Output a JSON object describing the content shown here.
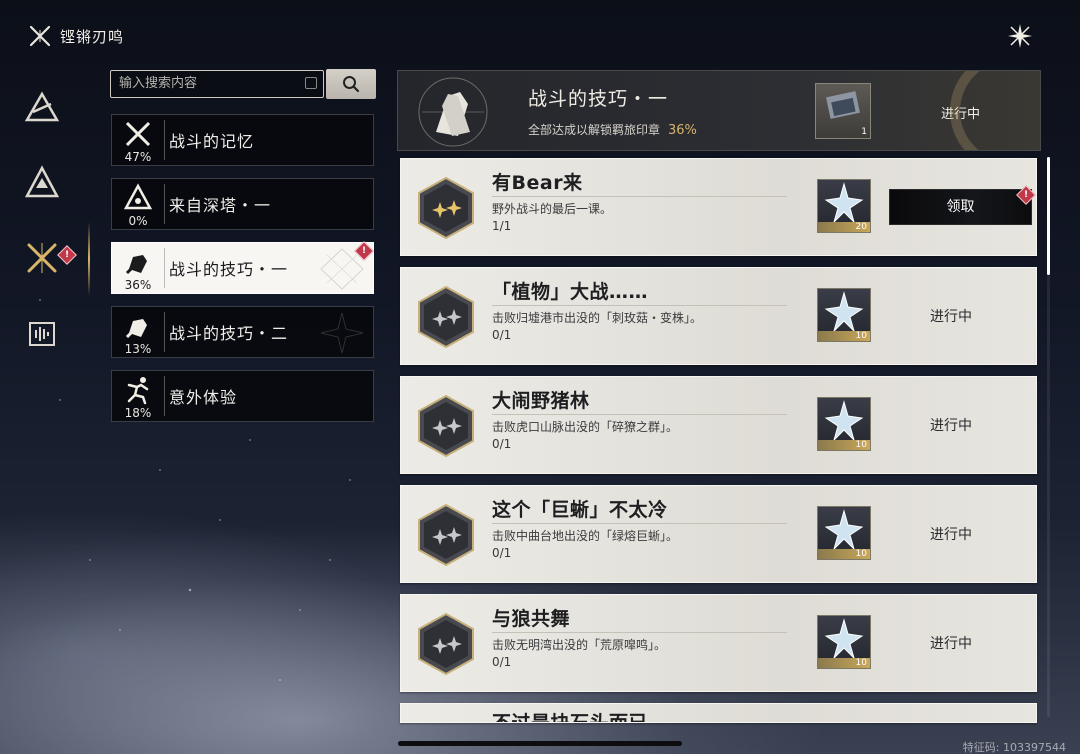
{
  "header": {
    "title": "铿锵刃鸣"
  },
  "search": {
    "placeholder": "输入搜索内容"
  },
  "categories": [
    {
      "label": "战斗的记忆",
      "percent": "47%",
      "active": false,
      "badge": false
    },
    {
      "label": "来自深塔・一",
      "percent": "0%",
      "active": false,
      "badge": false
    },
    {
      "label": "战斗的技巧・一",
      "percent": "36%",
      "active": true,
      "badge": true
    },
    {
      "label": "战斗的技巧・二",
      "percent": "13%",
      "active": false,
      "badge": false
    },
    {
      "label": "意外体验",
      "percent": "18%",
      "active": false,
      "badge": false
    }
  ],
  "summary": {
    "title": "战斗的技巧・一",
    "subtitle": "全部达成以解锁羁旅印章",
    "percent": "36%",
    "reward_count": "1",
    "status": "进行中"
  },
  "tasks": [
    {
      "title": "有Bear来",
      "desc": "野外战斗的最后一课。",
      "progress": "1/1",
      "reward_count": "20",
      "status": "领取",
      "claimable": true
    },
    {
      "title": "「植物」大战……",
      "desc": "击败归墟港市出没的「刺玫菇・变株」。",
      "progress": "0/1",
      "reward_count": "10",
      "status": "进行中",
      "claimable": false
    },
    {
      "title": "大闹野猪林",
      "desc": "击败虎口山脉出没的「碎獠之群」。",
      "progress": "0/1",
      "reward_count": "10",
      "status": "进行中",
      "claimable": false
    },
    {
      "title": "这个「巨蜥」不太冷",
      "desc": "击败中曲台地出没的「绿熔巨蜥」。",
      "progress": "0/1",
      "reward_count": "10",
      "status": "进行中",
      "claimable": false
    },
    {
      "title": "与狼共舞",
      "desc": "击败无明湾出没的「荒原噑鸣」。",
      "progress": "0/1",
      "reward_count": "10",
      "status": "进行中",
      "claimable": false
    },
    {
      "title": "不过是块石头而已……",
      "desc": "",
      "progress": "",
      "reward_count": "",
      "status": "",
      "claimable": false
    }
  ],
  "badge_glyph": "!",
  "watermark": "特征码: 103397544",
  "colors": {
    "accent_gold": "#d8b46a",
    "badge_red": "#c0394a"
  }
}
